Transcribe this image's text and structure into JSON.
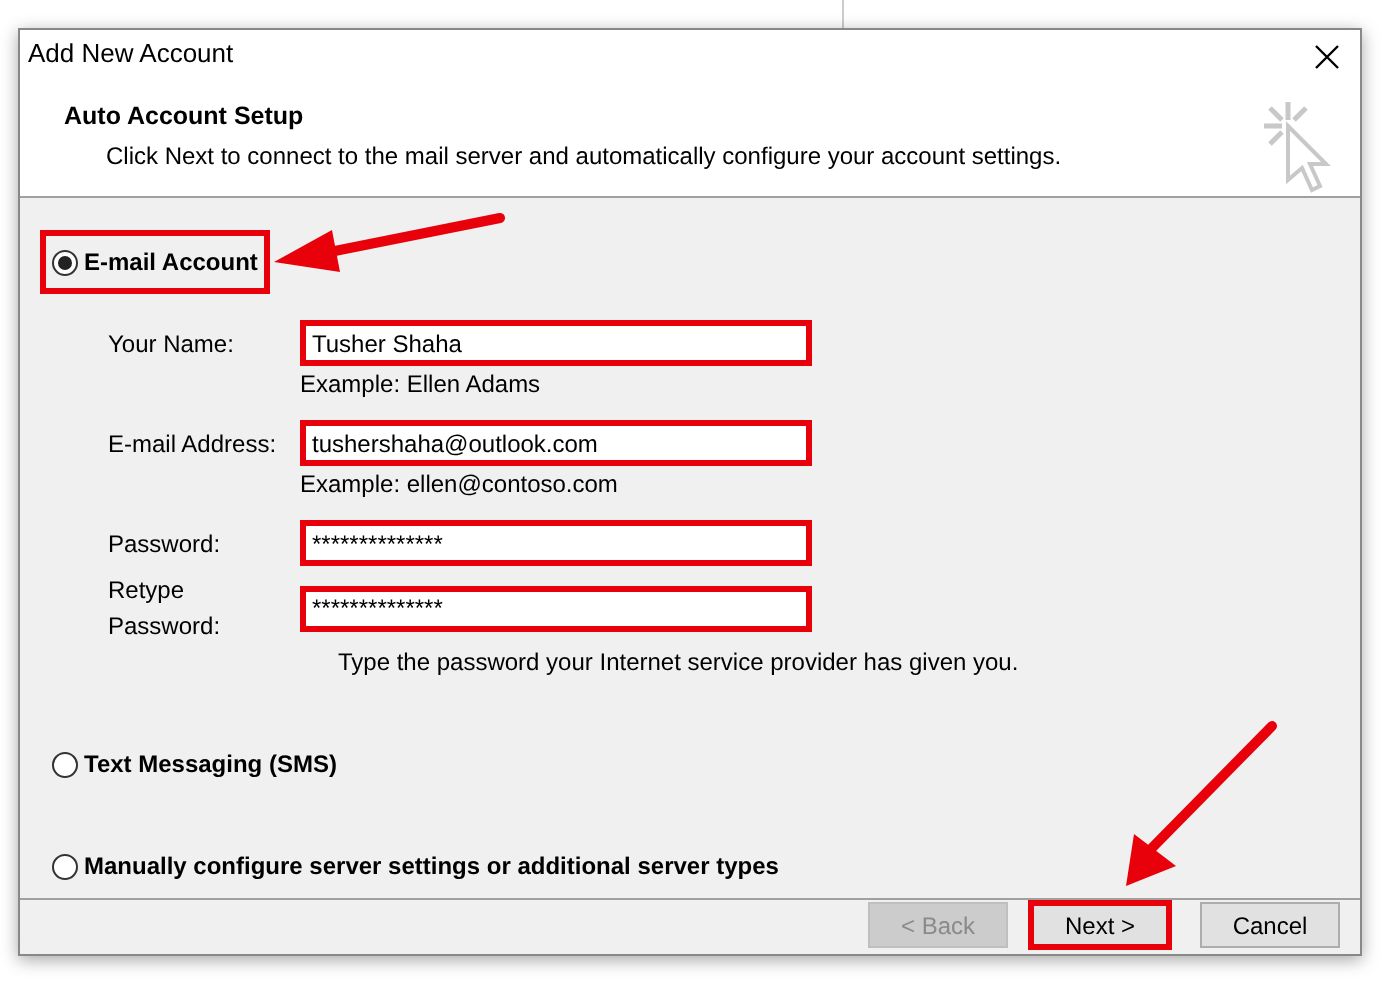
{
  "window": {
    "title": "Add New Account"
  },
  "header": {
    "title": "Auto Account Setup",
    "description": "Click Next to connect to the mail server and automatically configure your account settings."
  },
  "options": [
    {
      "label": "E-mail Account",
      "selected": true,
      "highlighted": true
    },
    {
      "label": "Text Messaging (SMS)",
      "selected": false,
      "highlighted": false
    },
    {
      "label": "Manually configure server settings or additional server types",
      "selected": false,
      "highlighted": false
    }
  ],
  "fields": [
    {
      "label": "Your Name:",
      "value": "Tusher Shaha",
      "hint": "Example: Ellen Adams",
      "highlighted": true
    },
    {
      "label": "E-mail Address:",
      "value": "tushershaha@outlook.com",
      "hint": "Example: ellen@contoso.com",
      "highlighted": true
    },
    {
      "label": "Password:",
      "value": "**************",
      "highlighted": true
    },
    {
      "label": "Retype Password:",
      "value": "**************",
      "hint": "Type the password your Internet service provider has given you.",
      "highlighted": true
    }
  ],
  "buttons": [
    {
      "label": "< Back",
      "disabled": true,
      "highlighted": false
    },
    {
      "label": "Next >",
      "disabled": false,
      "highlighted": true
    },
    {
      "label": "Cancel",
      "disabled": false,
      "highlighted": false
    }
  ]
}
